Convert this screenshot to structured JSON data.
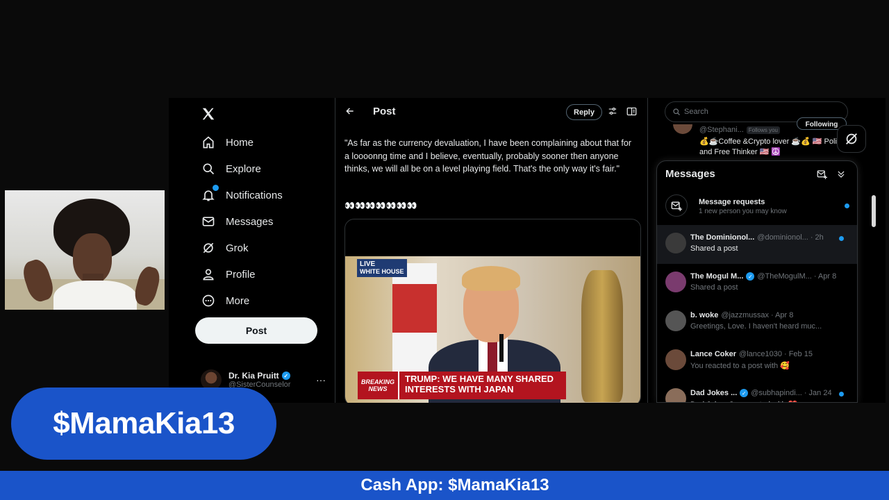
{
  "nav": {
    "logo": "𝕏",
    "items": [
      {
        "label": "Home",
        "icon": "home-icon"
      },
      {
        "label": "Explore",
        "icon": "search-icon"
      },
      {
        "label": "Notifications",
        "icon": "bell-icon"
      },
      {
        "label": "Messages",
        "icon": "envelope-icon"
      },
      {
        "label": "Grok",
        "icon": "grok-icon"
      },
      {
        "label": "Profile",
        "icon": "person-icon"
      },
      {
        "label": "More",
        "icon": "more-circle-icon"
      }
    ],
    "post_label": "Post",
    "account": {
      "name": "Dr. Kia Pruitt",
      "handle": "@SisterCounselor",
      "more": "···"
    }
  },
  "post": {
    "header_title": "Post",
    "reply_label": "Reply",
    "text": "\"As far as the currency devaluation, I have been complaining about that for a loooonng time and I believe, eventually, probably sooner then anyone thinks, we will all be on a level playing field. That's the only way it's fair.\"",
    "eyes": "👀👀👀👀👀👀👀",
    "video": {
      "live_label": "LIVE",
      "location_label": "WHITE HOUSE",
      "breaking_line1": "BREAKING",
      "breaking_line2": "NEWS",
      "headline": "TRUMP: WE HAVE MANY SHARED INTERESTS WITH JAPAN"
    }
  },
  "right": {
    "search_placeholder": "Search",
    "suggested": {
      "handle": "@Stephani...",
      "follows_you": "Follows you",
      "bio": "💰☕Coffee &Crypto lover ☕💰 🇺🇸 Politics and Free Thinker 🇺🇸 ☮️",
      "button": "Following"
    }
  },
  "messages": {
    "title": "Messages",
    "request": {
      "title": "Message requests",
      "subtitle": "1 new person you may know"
    },
    "conversations": [
      {
        "name": "The Dominionol...",
        "handle": "@dominionol...",
        "time": "· 2h",
        "preview": "Shared a post",
        "unread": true,
        "selected": true,
        "verified": false,
        "avatar_color": "#3a3a3a"
      },
      {
        "name": "The Mogul M...",
        "handle": "@TheMogulM...",
        "time": "· Apr 8",
        "preview": "Shared a post",
        "unread": false,
        "selected": false,
        "verified": true,
        "avatar_color": "#7a3b6e"
      },
      {
        "name": "b. woke",
        "handle": "@jazzmussax",
        "time": "· Apr 8",
        "preview": "Greetings, Love. I haven't heard muc...",
        "unread": false,
        "selected": false,
        "verified": false,
        "avatar_color": "#555555"
      },
      {
        "name": "Lance Coker",
        "handle": "@lance1030",
        "time": "· Feb 15",
        "preview": "You reacted to a post with 🥰",
        "unread": false,
        "selected": false,
        "verified": false,
        "avatar_color": "#6b4a3a"
      },
      {
        "name": "Dad Jokes ...",
        "handle": "@subhapindi...",
        "time": "· Jan 24",
        "preview": "Dad Jokes Commented with ❤️",
        "unread": true,
        "selected": false,
        "verified": true,
        "avatar_color": "#8a6d5a"
      }
    ]
  },
  "overlay": {
    "cashtag": "$MamaKia13",
    "footer": "Cash App: $MamaKia13"
  },
  "colors": {
    "accent": "#1d9bf0",
    "cashapp_blue": "#1a54c9",
    "background": "#000000"
  }
}
